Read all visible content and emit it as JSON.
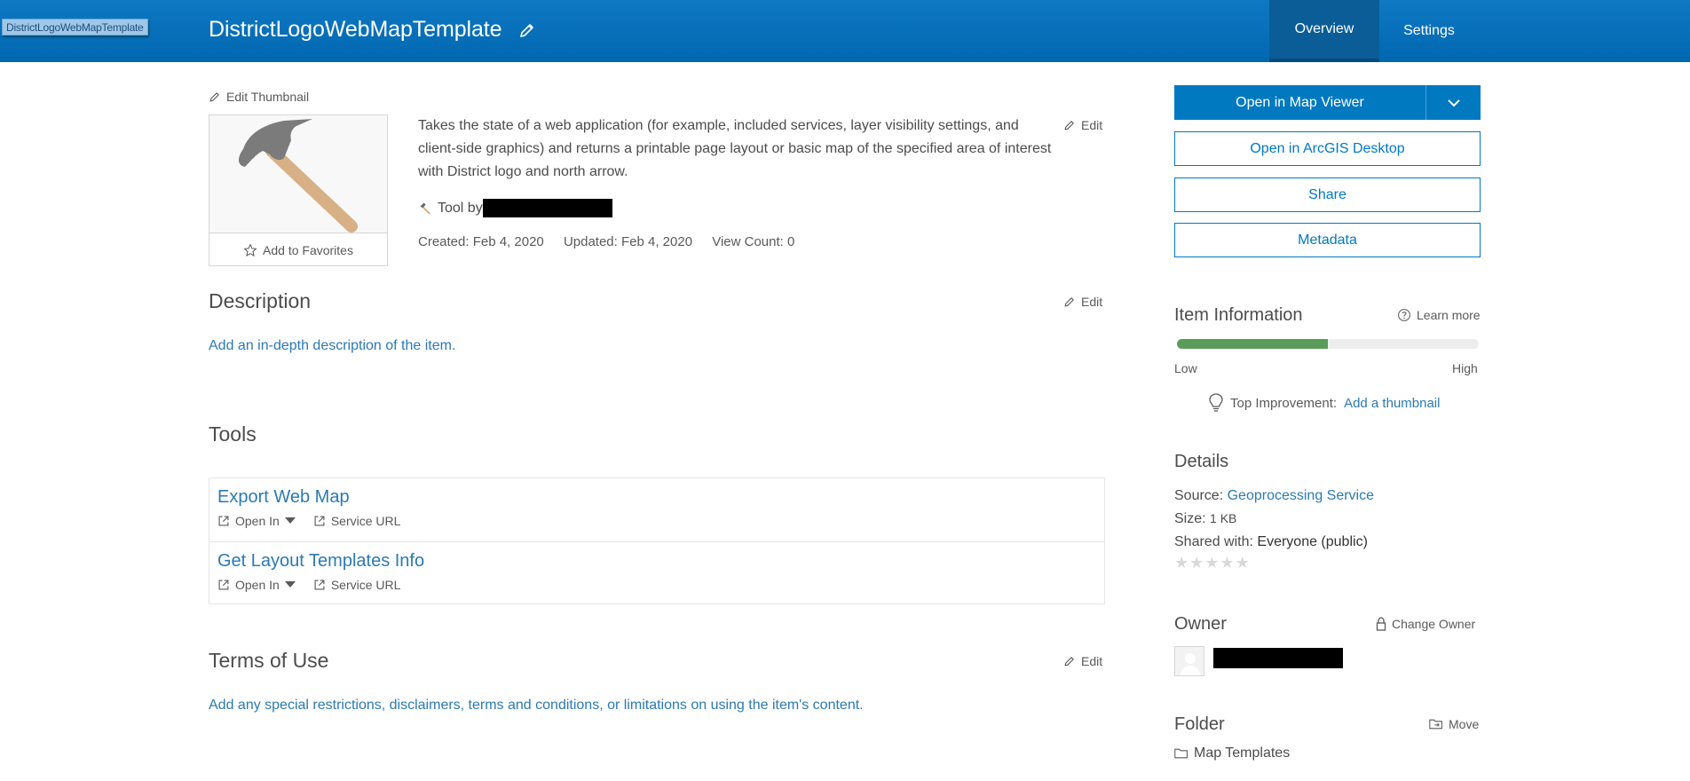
{
  "header": {
    "tooltip_tag": "DistrictLogoWebMapTemplate",
    "title": "DistrictLogoWebMapTemplate",
    "tabs": [
      {
        "label": "Overview",
        "active": true
      },
      {
        "label": "Settings",
        "active": false
      }
    ],
    "bg_color": "#0079c1"
  },
  "thumbnail": {
    "edit_label": "Edit Thumbnail",
    "favorites_label": "Add to Favorites",
    "icon": "hammer-icon"
  },
  "summary": {
    "text": "Takes the state of a web application (for example, included services, layer visibility settings, and client-side graphics) and returns a printable page layout or basic map of the specified area of interest with District logo and north arrow.",
    "edit_label": "Edit",
    "tool_by_label": "Tool by",
    "created": "Created: Feb 4, 2020",
    "updated": "Updated: Feb 4, 2020",
    "view_count": "View Count: 0"
  },
  "description": {
    "title": "Description",
    "edit_label": "Edit",
    "placeholder_link": "Add an in-depth description of the item."
  },
  "tools": {
    "title": "Tools",
    "items": [
      {
        "name": "Export Web Map",
        "open_in": "Open In",
        "service_url": "Service URL"
      },
      {
        "name": "Get Layout Templates Info",
        "open_in": "Open In",
        "service_url": "Service URL"
      }
    ]
  },
  "terms": {
    "title": "Terms of Use",
    "edit_label": "Edit",
    "placeholder_link": "Add any special restrictions, disclaimers, terms and conditions, or limitations on using the item's content."
  },
  "actions": {
    "open_map_viewer": "Open in Map Viewer",
    "open_arcgis_desktop": "Open in ArcGIS Desktop",
    "share": "Share",
    "metadata": "Metadata"
  },
  "item_information": {
    "title": "Item Information",
    "learn_more": "Learn more",
    "progress_fraction": 0.5,
    "low_label": "Low",
    "high_label": "High",
    "top_improvement_label": "Top Improvement:",
    "top_improvement_link": "Add a thumbnail"
  },
  "details": {
    "title": "Details",
    "source_label": "Source:",
    "source_value": "Geoprocessing Service",
    "size_label": "Size:",
    "size_value": "1 KB",
    "shared_label": "Shared with:",
    "shared_value": "Everyone (public)",
    "rating_stars": 0,
    "rating_max": 5
  },
  "owner": {
    "title": "Owner",
    "change_owner": "Change Owner"
  },
  "folder": {
    "title": "Folder",
    "move_label": "Move",
    "name": "Map Templates"
  }
}
